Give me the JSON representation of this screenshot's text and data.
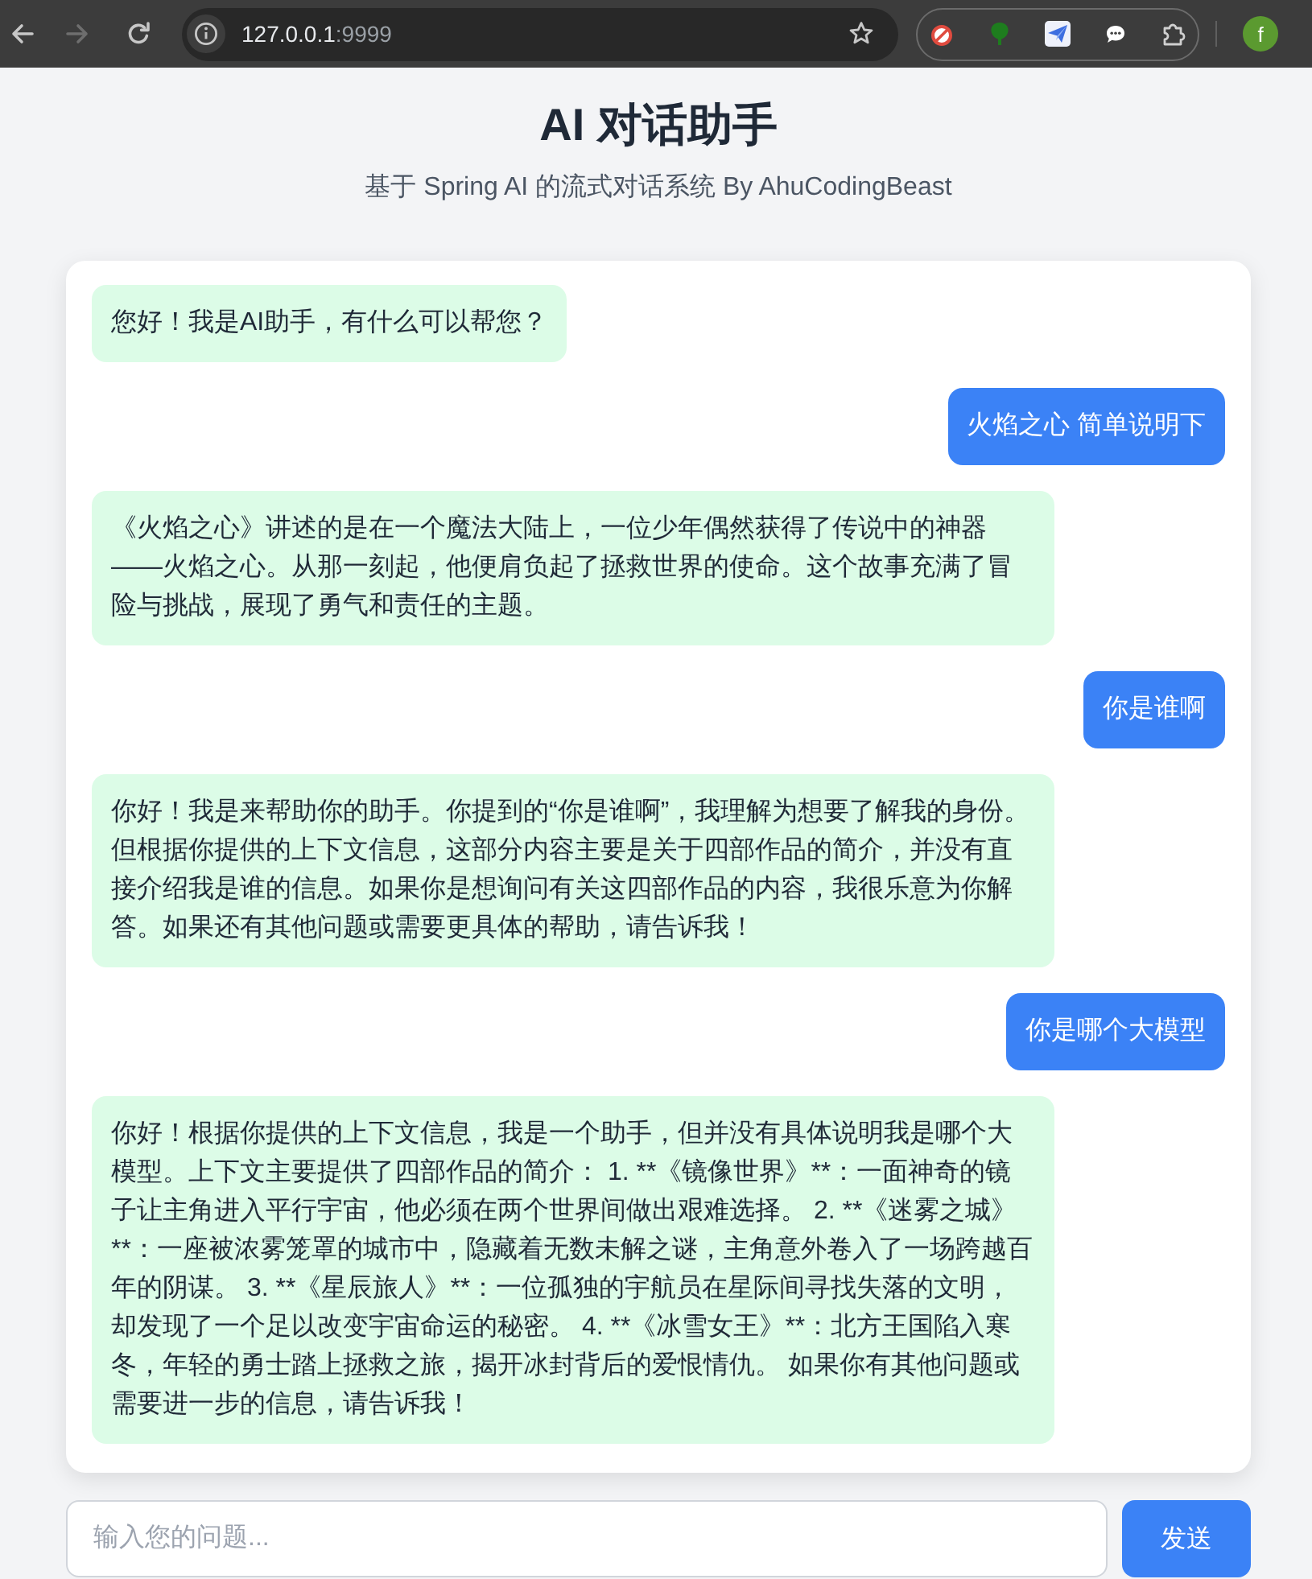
{
  "browser": {
    "nav_buttons": [
      {
        "kind": "back",
        "disabled": false
      },
      {
        "kind": "forward",
        "disabled": true
      },
      {
        "kind": "reload",
        "disabled": false
      }
    ],
    "url": {
      "host": "127.0.0.1",
      "port": ":9999"
    },
    "profile": {
      "initial": "f"
    }
  },
  "header": {
    "title": "AI 对话助手",
    "subtitle": "基于 Spring AI 的流式对话系统 By AhuCodingBeast"
  },
  "messages": [
    {
      "kind": "assistant",
      "text": "您好！我是AI助手，有什么可以帮您？"
    },
    {
      "kind": "user",
      "text": "火焰之心 简单说明下"
    },
    {
      "kind": "assistant",
      "text": "《火焰之心》讲述的是在一个魔法大陆上，一位少年偶然获得了传说中的神器——火焰之心。从那一刻起，他便肩负起了拯救世界的使命。这个故事充满了冒险与挑战，展现了勇气和责任的主题。"
    },
    {
      "kind": "user",
      "text": "你是谁啊"
    },
    {
      "kind": "assistant",
      "text": "你好！我是来帮助你的助手。你提到的“你是谁啊”，我理解为想要了解我的身份。但根据你提供的上下文信息，这部分内容主要是关于四部作品的简介，并没有直接介绍我是谁的信息。如果你是想询问有关这四部作品的内容，我很乐意为你解答。如果还有其他问题或需要更具体的帮助，请告诉我！"
    },
    {
      "kind": "user",
      "text": "你是哪个大模型"
    },
    {
      "kind": "assistant",
      "text": "你好！根据你提供的上下文信息，我是一个助手，但并没有具体说明我是哪个大模型。上下文主要提供了四部作品的简介： 1. **《镜像世界》**：一面神奇的镜子让主角进入平行宇宙，他必须在两个世界间做出艰难选择。 2. **《迷雾之城》**：一座被浓雾笼罩的城市中，隐藏着无数未解之谜，主角意外卷入了一场跨越百年的阴谋。 3. **《星辰旅人》**：一位孤独的宇航员在星际间寻找失落的文明，却发现了一个足以改变宇宙命运的秘密。 4. **《冰雪女王》**：北方王国陷入寒冬，年轻的勇士踏上拯救之旅，揭开冰封背后的爱恨情仇。 如果你有其他问题或需要进一步的信息，请告诉我！"
    }
  ],
  "composer": {
    "placeholder": "输入您的问题...",
    "send_button": "发送"
  }
}
